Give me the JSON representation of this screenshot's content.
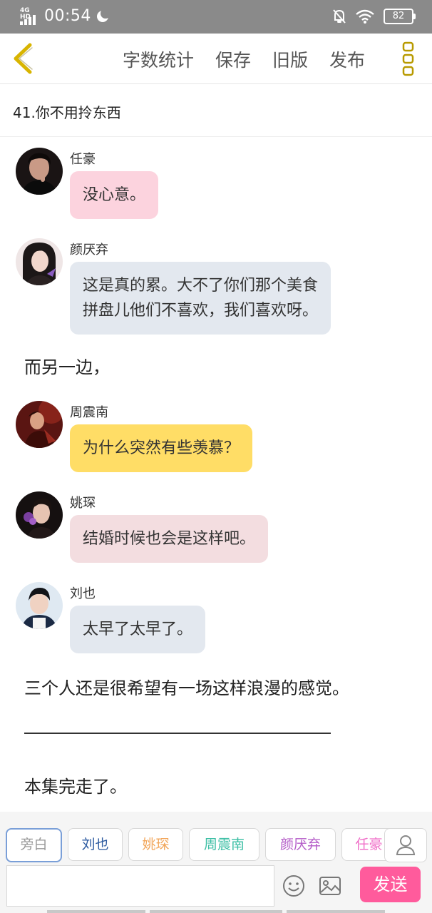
{
  "status_bar": {
    "network": "4G HD",
    "time": "00:54",
    "battery": "82"
  },
  "nav": {
    "word_count": "字数统计",
    "save": "保存",
    "old_version": "旧版",
    "publish": "发布"
  },
  "episode_title": "41.你不用拎东西",
  "messages": [
    {
      "speaker": "任豪",
      "text": "没心意。",
      "bubble_color": "#fcd3de"
    },
    {
      "speaker": "颜厌弃",
      "lines": [
        "这是真的累。大不了你们那个美食",
        "拼盘儿他们不喜欢，我们喜欢呀。"
      ],
      "bubble_color": "#e3e8ef"
    },
    {
      "speaker": "周震南",
      "text": "为什么突然有些羡慕？",
      "bubble_color": "#ffdd66"
    },
    {
      "speaker": "姚琛",
      "text": "结婚时候也会是这样吧。",
      "bubble_color": "#f3dde0"
    },
    {
      "speaker": "刘也",
      "text": "太早了太早了。",
      "bubble_color": "#e3e8ef"
    }
  ],
  "narrations": [
    "而另一边，",
    "三个人还是很希望有一场这样浪漫的感觉。",
    "本集完走了。"
  ],
  "character_chips": [
    {
      "label": "旁白",
      "color": "#999999",
      "selected": true
    },
    {
      "label": "刘也",
      "color": "#2c5aa0"
    },
    {
      "label": "姚琛",
      "color": "#f2a65a"
    },
    {
      "label": "周震南",
      "color": "#3dbfa5"
    },
    {
      "label": "颜厌弃",
      "color": "#b45cc8"
    },
    {
      "label": "任豪",
      "color": "#f06ec8"
    }
  ],
  "composer": {
    "input_value": "",
    "send_label": "发送"
  },
  "colors": {
    "status_bar": "#8a8a8a",
    "back_arrow": "#d8b400",
    "send_button": "#ff5b9c"
  }
}
